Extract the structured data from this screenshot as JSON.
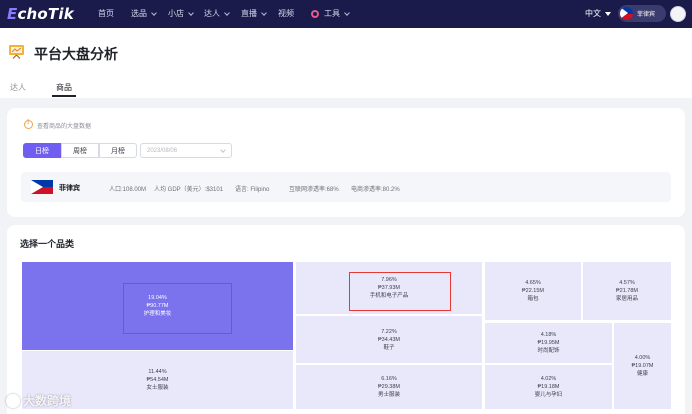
{
  "nav": {
    "logo_prefix": "E",
    "logo_rest": "choTik",
    "items": [
      {
        "label": "首页",
        "dropdown": false
      },
      {
        "label": "选品",
        "dropdown": true
      },
      {
        "label": "小店",
        "dropdown": true
      },
      {
        "label": "达人",
        "dropdown": true
      },
      {
        "label": "直播",
        "dropdown": true
      },
      {
        "label": "视频",
        "dropdown": false
      },
      {
        "label": "工具",
        "dropdown": true
      }
    ],
    "language": "中文",
    "country": "菲律宾"
  },
  "header": {
    "title": "平台大盘分析",
    "tabs": [
      {
        "label": "达人",
        "active": false
      },
      {
        "label": "商品",
        "active": true
      }
    ]
  },
  "filters": {
    "info": "查看商品的大盘数据",
    "periods": [
      "日榜",
      "周榜",
      "月榜"
    ],
    "active_period": "日榜",
    "date": "2023/08/06"
  },
  "country_info": {
    "name": "菲律宾",
    "population": "人口:108.00M",
    "gdp": "人均 GDP（美元）:$3101",
    "language": "语言: Filipino",
    "internet": "互联网渗透率:68%",
    "ecommerce": "电商渗透率:80.2%"
  },
  "treemap": {
    "title": "选择一个品类",
    "tiles": [
      {
        "pct": "19.04%",
        "value": "₱90.77M",
        "name": "护理和美妆",
        "highlight": true
      },
      {
        "pct": "11.44%",
        "value": "₱54.54M",
        "name": "女士服装"
      },
      {
        "pct": "7.96%",
        "value": "₱37.93M",
        "name": "手机和电子产品",
        "highlight": true
      },
      {
        "pct": "7.22%",
        "value": "₱34.43M",
        "name": "鞋子"
      },
      {
        "pct": "6.16%",
        "value": "₱29.38M",
        "name": "男士服装"
      },
      {
        "pct": "4.65%",
        "value": "₱22.15M",
        "name": "箱包"
      },
      {
        "pct": "4.57%",
        "value": "₱21.78M",
        "name": "家居用品"
      },
      {
        "pct": "4.18%",
        "value": "₱19.95M",
        "name": "时尚配饰"
      },
      {
        "pct": "4.02%",
        "value": "₱19.18M",
        "name": "婴儿与孕妇"
      },
      {
        "pct": "4.00%",
        "value": "₱19.07M",
        "name": "健康"
      }
    ]
  },
  "colors": {
    "nav_bg": "#1a1b4b",
    "accent": "#6f5ef0",
    "tile_main": "#7b72ee",
    "tile_light": "#e9e8fb",
    "highlight_box": "#e53935"
  },
  "watermark": "大数跨境"
}
